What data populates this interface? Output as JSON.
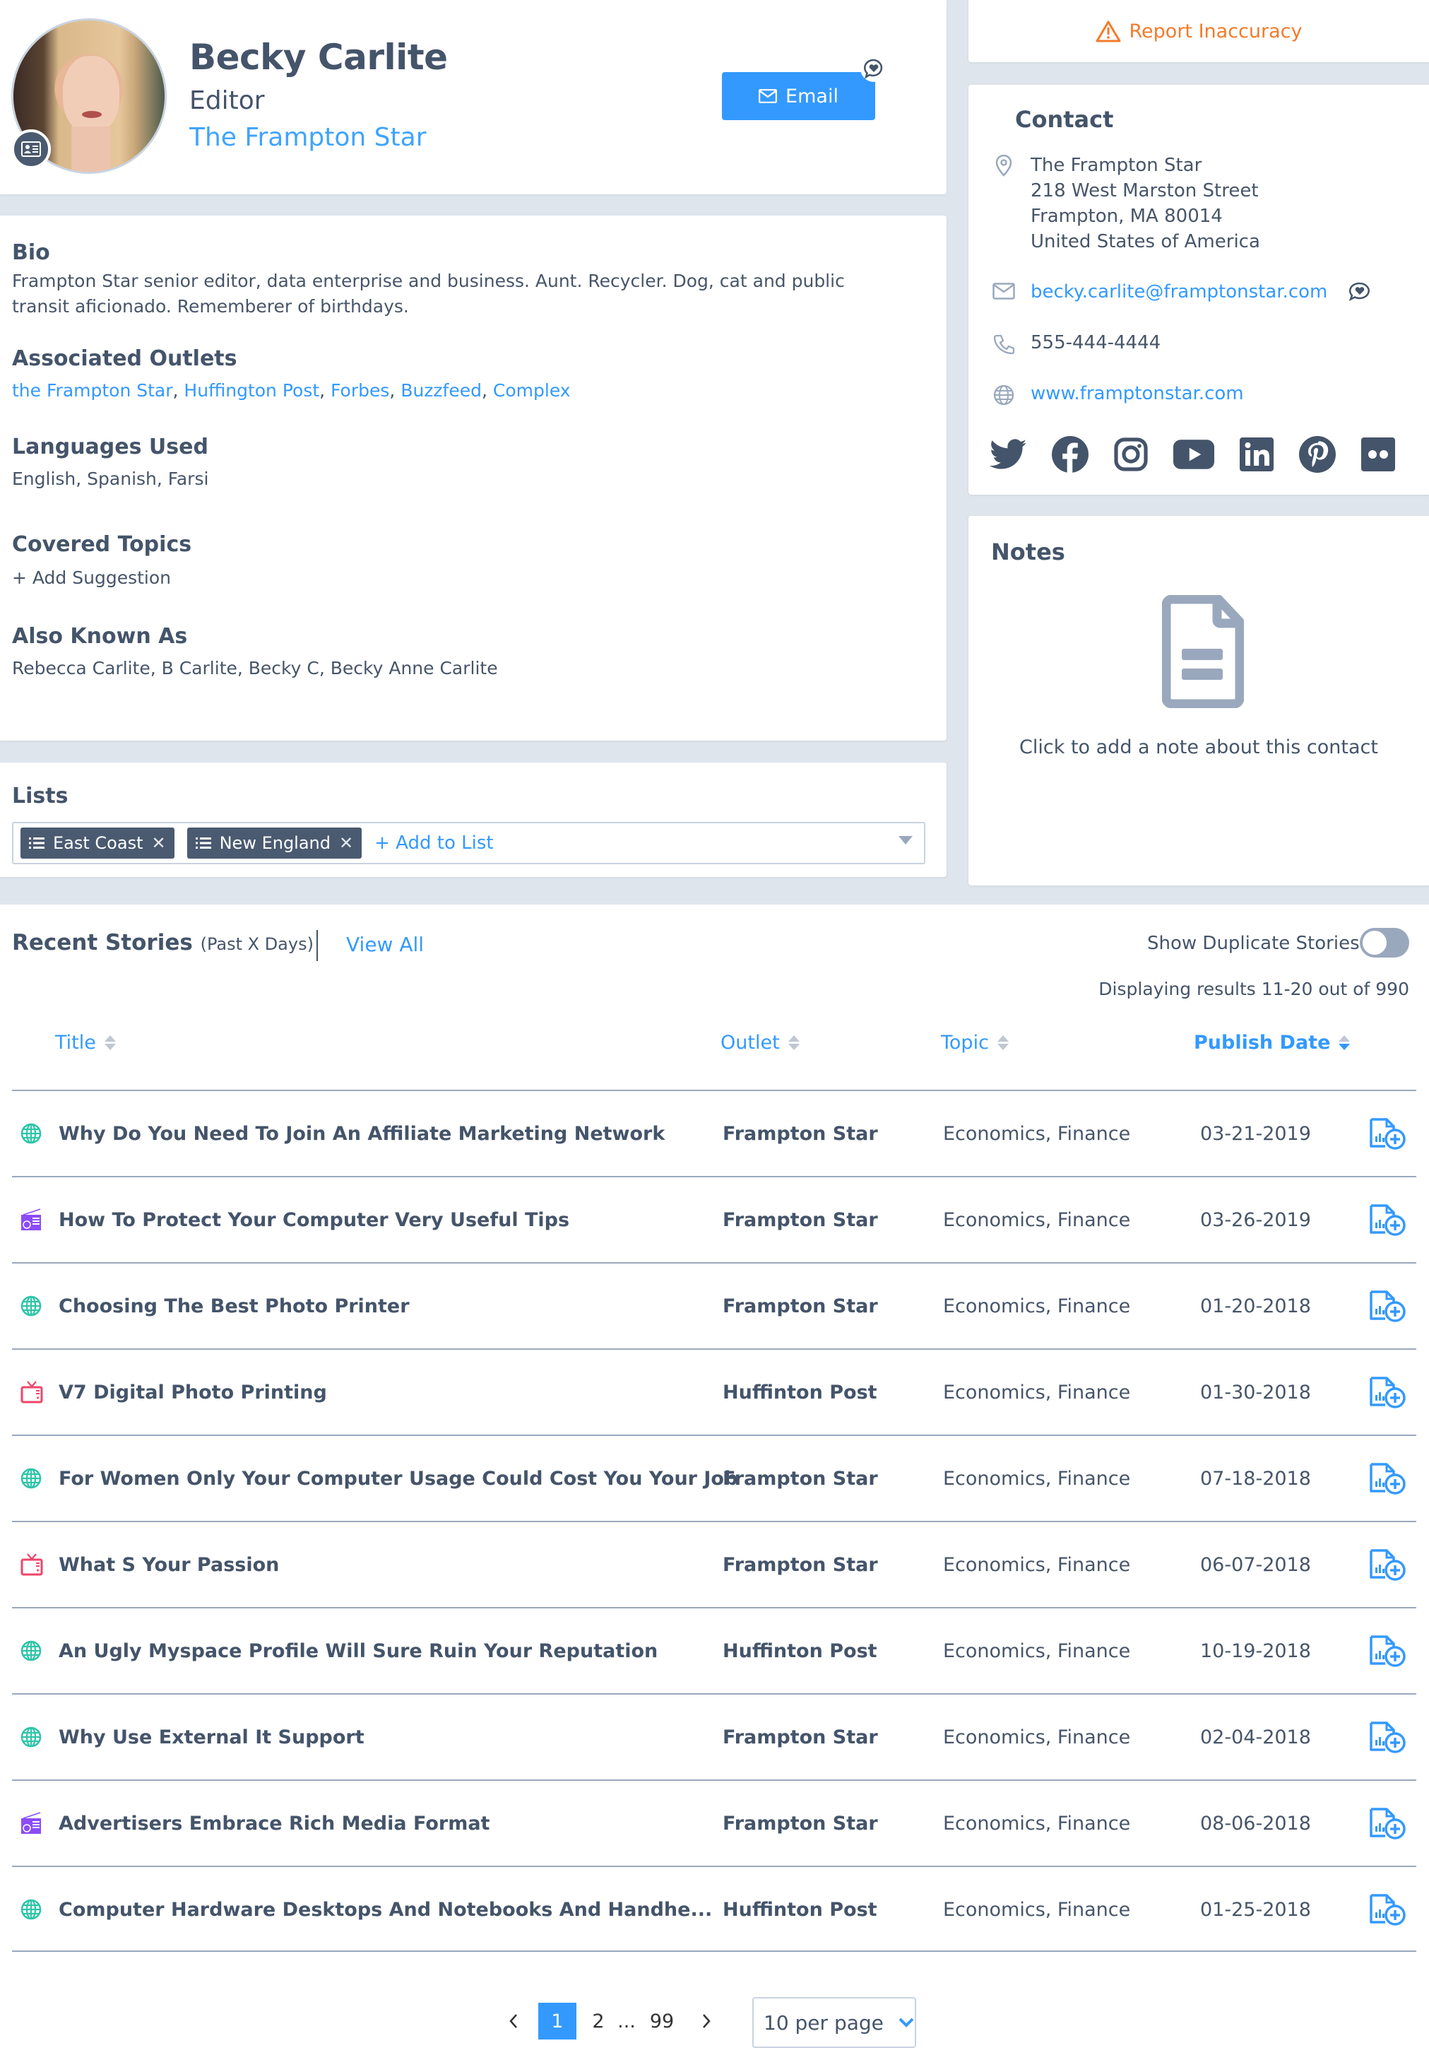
{
  "profile": {
    "name": "Becky Carlite",
    "job_title": "Editor",
    "outlet": "The Frampton Star",
    "email_button": "Email"
  },
  "bio": {
    "title": "Bio",
    "text": "Frampton Star senior editor, data enterprise and business. Aunt. Recycler. Dog, cat and public transit aficionado. Rememberer of birthdays."
  },
  "associated_outlets": {
    "title": "Associated Outlets",
    "items": [
      "the Frampton Star",
      "Huffington Post",
      "Forbes",
      "Buzzfeed",
      "Complex"
    ]
  },
  "languages": {
    "title": "Languages Used",
    "text": "English, Spanish, Farsi"
  },
  "covered_topics": {
    "title": "Covered Topics",
    "add_label": "+ Add Suggestion"
  },
  "aka": {
    "title": "Also Known As",
    "text": "Rebecca Carlite, B Carlite, Becky C, Becky Anne Carlite"
  },
  "lists": {
    "title": "Lists",
    "chips": [
      "East Coast",
      "New England"
    ],
    "add_label": "+ Add to List"
  },
  "report": {
    "label": "Report Inaccuracy",
    "color": "#f47a2a"
  },
  "contact": {
    "title": "Contact",
    "address": [
      "The Frampton Star",
      "218 West Marston Street",
      "Frampton, MA 80014",
      "United States of America"
    ],
    "email": "becky.carlite@framptonstar.com",
    "phone": "555-444-4444",
    "website": "www.framptonstar.com",
    "social": [
      "twitter",
      "facebook",
      "instagram",
      "youtube",
      "linkedin",
      "pinterest",
      "flickr"
    ]
  },
  "notes": {
    "title": "Notes",
    "cta": "Click to add a note about this contact"
  },
  "stories": {
    "title": "Recent Stories",
    "subtitle": "(Past X Days)",
    "view_all": "View All",
    "duplicate_label": "Show Duplicate Stories",
    "duplicate_on": false,
    "results_text": "Displaying results 11-20 out of 990",
    "columns": [
      "Title",
      "Outlet",
      "Topic",
      "Publish Date"
    ],
    "sorted_column": "Publish Date",
    "rows": [
      {
        "type": "web",
        "title": "Why Do You Need To Join An Affiliate Marketing Network",
        "outlet": "Frampton Star",
        "topic": "Economics, Finance",
        "date": "03-21-2019"
      },
      {
        "type": "radio",
        "title": "How To Protect Your Computer Very Useful Tips",
        "outlet": "Frampton Star",
        "topic": "Economics, Finance",
        "date": "03-26-2019"
      },
      {
        "type": "web",
        "title": "Choosing The Best Photo Printer",
        "outlet": "Frampton Star",
        "topic": "Economics, Finance",
        "date": "01-20-2018"
      },
      {
        "type": "tv",
        "title": "V7 Digital Photo Printing",
        "outlet": "Huffinton Post",
        "topic": "Economics, Finance",
        "date": "01-30-2018"
      },
      {
        "type": "web",
        "title": "For Women Only Your Computer Usage Could Cost You Your Job",
        "outlet": "Frampton Star",
        "topic": "Economics, Finance",
        "date": "07-18-2018"
      },
      {
        "type": "tv",
        "title": "What S Your Passion",
        "outlet": "Frampton Star",
        "topic": "Economics, Finance",
        "date": "06-07-2018"
      },
      {
        "type": "web",
        "title": "An Ugly Myspace Profile Will Sure Ruin Your Reputation",
        "outlet": "Huffinton Post",
        "topic": "Economics, Finance",
        "date": "10-19-2018"
      },
      {
        "type": "web",
        "title": "Why Use External It Support",
        "outlet": "Frampton Star",
        "topic": "Economics, Finance",
        "date": "02-04-2018"
      },
      {
        "type": "radio",
        "title": "Advertisers Embrace Rich Media Format",
        "outlet": "Frampton Star",
        "topic": "Economics, Finance",
        "date": "08-06-2018"
      },
      {
        "type": "web",
        "title": "Computer Hardware Desktops And Notebooks And Handhe...",
        "outlet": "Huffinton Post",
        "topic": "Economics, Finance",
        "date": "01-25-2018"
      }
    ]
  },
  "pagination": {
    "pages": [
      "1",
      "2",
      "...",
      "99"
    ],
    "current": "1",
    "per_page": "10 per page"
  },
  "colors": {
    "accent": "#3399ff",
    "text": "#44546a",
    "web_icon": "#2ec4a9",
    "radio_icon": "#8b4cf7",
    "tv_icon": "#f0456a",
    "divider": "#9aa8bd"
  }
}
